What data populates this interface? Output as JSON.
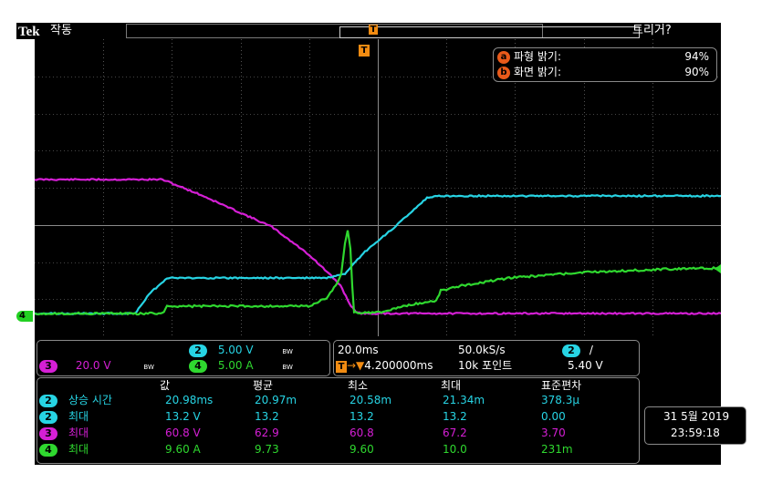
{
  "topbar": {
    "brand": "Tek",
    "mode": "작동",
    "trigger_status": "트리거?"
  },
  "brightness": {
    "waveform": {
      "badge": "a",
      "label": "파형 밝기:",
      "value": "94%"
    },
    "screen": {
      "badge": "b",
      "label": "화면 밝기:",
      "value": "90%"
    }
  },
  "markers": {
    "trigger_top": "T",
    "trigger_grid": "T",
    "ch4_ground": "4"
  },
  "colors": {
    "ch2": "#27d4e4",
    "ch3": "#d51fd5",
    "ch4": "#2fd82f",
    "trigger": "#f28c12",
    "grid": "#8a8a8a"
  },
  "channels": {
    "ch2": {
      "badge": "2",
      "scale": "5.00 V",
      "bw": "BW"
    },
    "ch3": {
      "badge": "3",
      "scale": "20.0 V",
      "bw": "BW"
    },
    "ch4": {
      "badge": "4",
      "scale": "5.00 A",
      "bw": "BW"
    }
  },
  "timebase": {
    "scale": "20.0ms",
    "sample_rate": "50.0kS/s",
    "trig_ch": "2",
    "slope": "/",
    "trig_arrow": "→▼",
    "position": "4.200000ms",
    "record": "10k 포인트",
    "level": "5.40 V"
  },
  "measurements": {
    "headers": [
      "값",
      "평균",
      "최소",
      "최대",
      "표준편차"
    ],
    "rows": [
      {
        "ch": "2",
        "name": "상승 시간",
        "value": "20.98ms",
        "mean": "20.97m",
        "min": "20.58m",
        "max": "21.34m",
        "std": "378.3μ"
      },
      {
        "ch": "2",
        "name": "최대",
        "value": "13.2 V",
        "mean": "13.2",
        "min": "13.2",
        "max": "13.2",
        "std": "0.00"
      },
      {
        "ch": "3",
        "name": "최대",
        "value": "60.8 V",
        "mean": "62.9",
        "min": "60.8",
        "max": "67.2",
        "std": "3.70"
      },
      {
        "ch": "4",
        "name": "최대",
        "value": "9.60 A",
        "mean": "9.73",
        "min": "9.60",
        "max": "10.0",
        "std": "231m"
      }
    ]
  },
  "datetime": {
    "date": "31 5월 2019",
    "time": "23:59:18"
  }
}
